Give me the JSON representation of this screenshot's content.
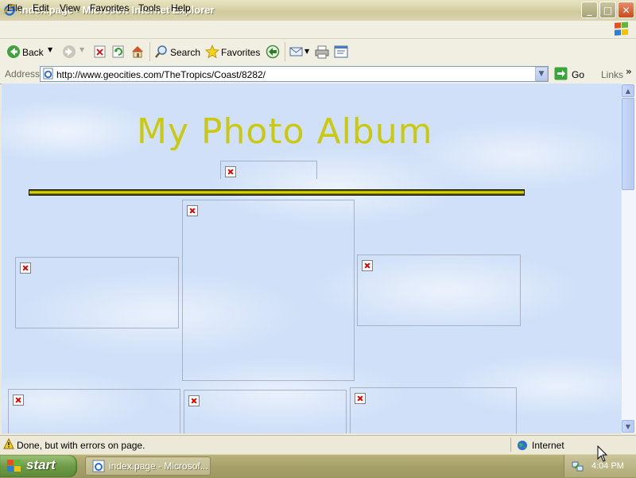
{
  "window": {
    "title": "index.page - Microsoft Internet Explorer",
    "minimize_label": "_",
    "maximize_label": "□",
    "close_label": "✕"
  },
  "menu": {
    "items": [
      "File",
      "Edit",
      "View",
      "Favorites",
      "Tools",
      "Help"
    ]
  },
  "toolbar": {
    "back_label": "Back",
    "search_label": "Search",
    "favorites_label": "Favorites"
  },
  "address": {
    "label": "Address",
    "url": "http://www.geocities.com/TheTropics/Coast/8282/",
    "go_label": "Go",
    "links_label": "Links"
  },
  "page": {
    "title": "My Photo Album"
  },
  "status": {
    "text": "Done, but with errors on page.",
    "zone": "Internet"
  },
  "taskbar": {
    "start_label": "start",
    "task_label": "index.page - Microsof...",
    "clock": "4:04 PM"
  },
  "colors": {
    "title_text": "#CBC90E",
    "page_background": "#CFE0F8",
    "divider": "#F4F000"
  }
}
